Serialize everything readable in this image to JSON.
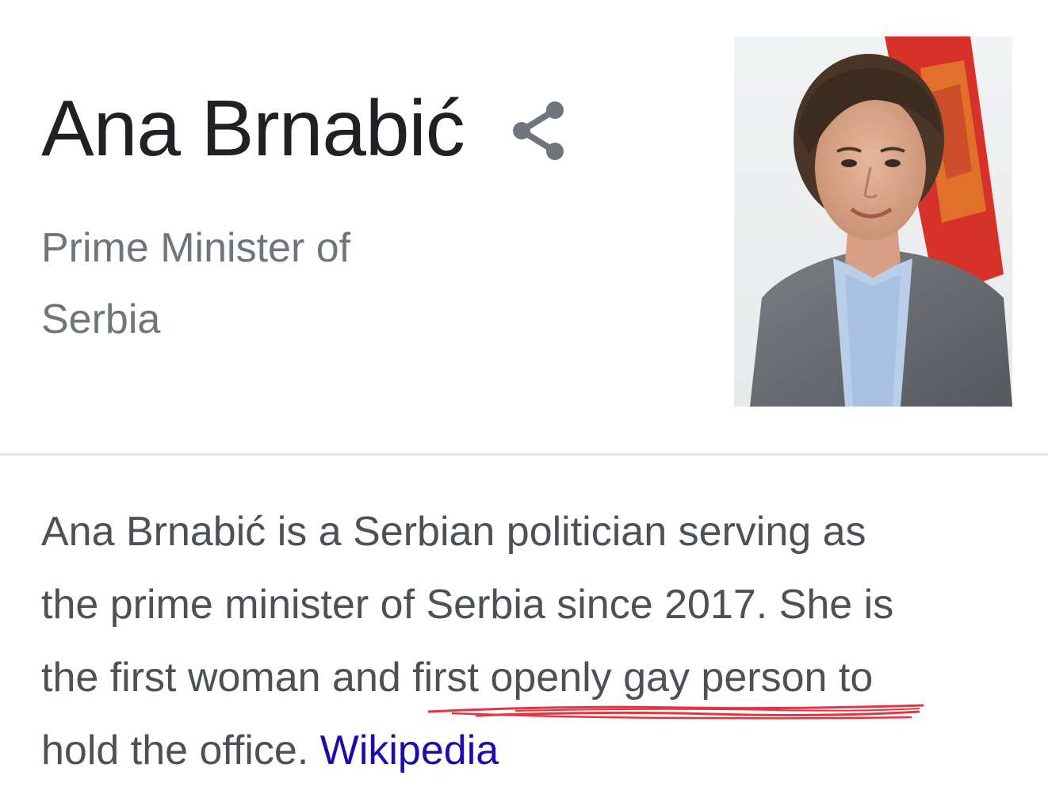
{
  "header": {
    "title": "Ana Brnabić",
    "share_icon": "share-icon",
    "subtitle_line1": "Prime Minister of",
    "subtitle_line2": "Serbia"
  },
  "photo": {
    "icon": "portrait-photo",
    "flag_colors": [
      "#d7322a",
      "#e9a52a"
    ]
  },
  "description": {
    "line1": "Ana Brnabić is a Serbian politician serving as",
    "line2": "the prime minister of Serbia since 2017. She is",
    "line3_prefix": "the first woman and ",
    "line3_highlight": "first openly gay person",
    "line3_suffix": " to",
    "line4": "hold the office. ",
    "source_link": "Wikipedia"
  },
  "annotation": {
    "color": "#e8333f"
  }
}
